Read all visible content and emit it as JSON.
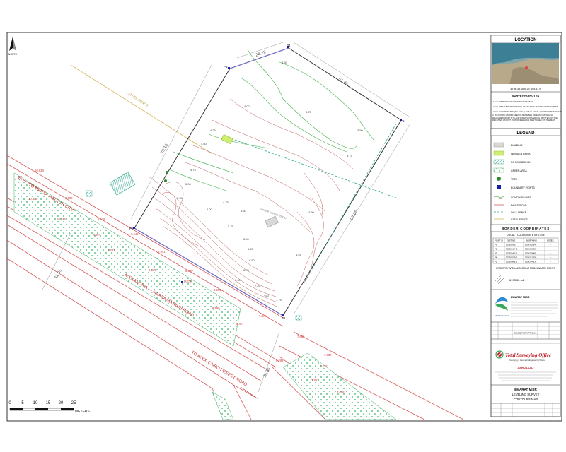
{
  "north_arrow": {
    "label": "NORTH"
  },
  "map": {
    "road_labels": {
      "marsa_city": "TO MARSA MATRUH CITY",
      "alex_marsa": "ALEXANDRIA — MARSA MATRUH ROAD",
      "alex_cairo": "TO ALEX-CAIRO DESERT ROAD"
    },
    "steel_fence_label": "STEEL FENCE",
    "water_supply_label": "WATER SUPPLY ROOM",
    "points": {
      "p1": "P1",
      "p2": "P2",
      "p3": "P3",
      "p4": "P4",
      "p5": "P5"
    },
    "dimensions": {
      "top_short": "24.29",
      "top_long": "51.86",
      "left_side": "75.18",
      "right_side": "92.05",
      "road_width_left": "11.05",
      "road_width_bottom": "36.05"
    },
    "spot_levels": {
      "l1": "10.639",
      "l2": "10.355",
      "l3": "9.992",
      "l4": "9.539",
      "l5": "10.145",
      "l6": "9.874",
      "l7": "9.482",
      "l8": "9.242",
      "l9": "8.941",
      "l10": "9.319",
      "l11": "8.580",
      "l12": "8.875",
      "l13": "8.294",
      "l14": "8.590",
      "l15": "8.427",
      "l16": "7.878",
      "l17": "7.656",
      "l18": "7.389",
      "l19": "7.228",
      "l20": "8.298",
      "l21": "7.893",
      "l22": "7.658"
    },
    "contours": {
      "c1": "3.50",
      "c2": "3.75",
      "c3": "4.00",
      "c4": "3.50",
      "c5": "3.75",
      "c6": "4.25",
      "c7": "4.50",
      "c8": "4.75",
      "c9": "5.00",
      "c10": "5.25",
      "c11": "5.50",
      "c12": "5.75",
      "c13": "6.00",
      "c14": "6.25",
      "c15": "6.50",
      "c16": "6.75",
      "c17": "7.00",
      "c18": "7.25",
      "c19": "7.50",
      "c20": "7.75",
      "c21": "4.75",
      "c22": "5.00",
      "c23": "4.50",
      "c24": "4.25"
    }
  },
  "scale_bar": {
    "ticks": [
      "0",
      "5",
      "10",
      "15",
      "20",
      "25"
    ],
    "unit": "METERS"
  },
  "title_block": {
    "location_header": "LOCATION",
    "coords": "30°58'33.65\"N  28°44'5.37\"E",
    "notes_title": "SURVEYING NOTES",
    "notes": [
      "1. ALL DIMENSIONS ARE IN METERS UNIT.",
      "2. ALL MEASUREMENTS DONE USING TOTAL STATION INSTRUMENT.",
      "3. ALL COORDINATES (X,Y AND Z) ARE IN LOCAL COORDINATE SYSTEM.",
      "4. WE FOUND AN DIFFERENCE BETWEEN DIMENSIONS WHICH MEASURED FROM SITE AND DIMENSIONS WHICH WRITTEN ON THE RECEIVED LAYOUT. THIS DIFFERENCE MENTIONED ON THE MAP."
    ],
    "legend_title": "LEGEND",
    "legend": [
      {
        "label": "BUILDING",
        "kind": "building"
      },
      {
        "label": "WOODEN KIOSK",
        "kind": "kiosk"
      },
      {
        "label": "RC FOUNDATION",
        "kind": "rc"
      },
      {
        "label": "GREEN AREA",
        "kind": "green"
      },
      {
        "label": "TREE",
        "kind": "tree"
      },
      {
        "label": "BOUNDARY POINTS",
        "kind": "bpoint"
      },
      {
        "label": "CONTOUR LINES",
        "kind": "contour"
      },
      {
        "label": "PAVED ROAD",
        "kind": "road"
      },
      {
        "label": "WALL FENCE",
        "kind": "wall"
      },
      {
        "label": "STEEL FENCE",
        "kind": "steel"
      }
    ],
    "border_title": "BORDER COORDINATES",
    "coord_system": "LOCAL - COORDINATE SYSTEM",
    "table_headers": [
      "POINT ID",
      "EASTING",
      "NORTHING",
      "NOTES"
    ],
    "table_rows": [
      [
        "P1",
        "5023046.57",
        "1056325.942",
        "-"
      ],
      [
        "P2",
        "5022981.448",
        "1056325.957",
        "-"
      ],
      [
        "P3",
        "5023024.011",
        "1056329.481",
        "-"
      ],
      [
        "P4",
        "5023070.741",
        "1056321.596",
        "-"
      ],
      [
        "P5",
        "5023098.871",
        "1056264.632",
        "-"
      ]
    ],
    "area_label": "PROPERTY AREA ACCORDING TO BOUNDARY POINTS",
    "area_value": "6133.30 m2",
    "client": "EMARAT MISR",
    "client_sub": "OWNER",
    "rev_label": "ISSUED FOR APPROVAL",
    "office_title": "Total Surveying Office",
    "office_tagline": "Surveying & Geomatics Engineering Works",
    "office_person": "AMR ALI ALI",
    "project_name": "EMARAT MISR",
    "project_sub1": "LEVELING SURVEY",
    "project_sub2": "CONTOURS MAP"
  }
}
